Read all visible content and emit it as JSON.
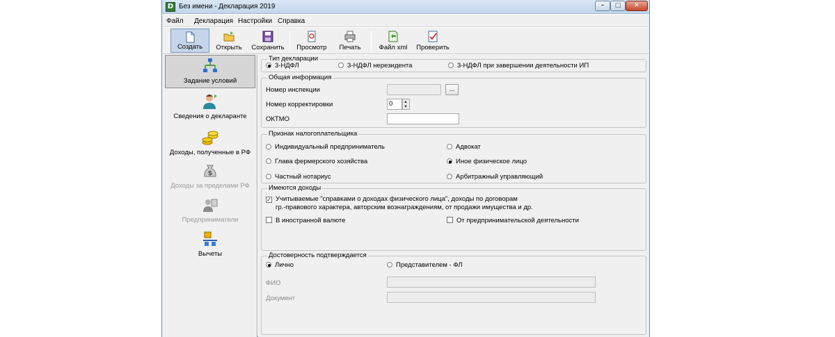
{
  "window": {
    "title": "Без имени - Декларация 2019",
    "app_icon": "D"
  },
  "title_buttons": {
    "minimize": "–",
    "maximize": "□",
    "close": "✕"
  },
  "menu": [
    "Файл",
    "Декларация",
    "Настройки",
    "Справка"
  ],
  "toolbar": [
    {
      "label": "Создать",
      "icon": "new-document-icon",
      "active": true
    },
    {
      "label": "Открыть",
      "icon": "open-folder-icon"
    },
    {
      "label": "Сохранить",
      "icon": "save-floppy-icon"
    },
    {
      "label": "Просмотр",
      "icon": "preview-icon"
    },
    {
      "label": "Печать",
      "icon": "printer-icon"
    },
    {
      "label": "Файл xml",
      "icon": "xml-file-icon"
    },
    {
      "label": "Проверить",
      "icon": "check-document-icon"
    }
  ],
  "sidebar": [
    {
      "label": "Задание условий",
      "icon": "conditions-tree-icon",
      "active": true,
      "enabled": true
    },
    {
      "label": "Сведения о декларанте",
      "icon": "person-icon",
      "enabled": true
    },
    {
      "label": "Доходы, полученные в РФ",
      "icon": "coins-icon",
      "enabled": true
    },
    {
      "label": "Доходы за пределами РФ",
      "icon": "money-bag-icon",
      "enabled": false
    },
    {
      "label": "Предприниматели",
      "icon": "entrepreneur-icon",
      "enabled": false
    },
    {
      "label": "Вычеты",
      "icon": "deductions-icon",
      "enabled": true
    }
  ],
  "declaration_type": {
    "title": "Тип декларации",
    "options": [
      "3-НДФЛ",
      "3-НДФЛ нерезидента",
      "3-НДФЛ при завершении деятельности ИП"
    ],
    "selected": "3-НДФЛ"
  },
  "general": {
    "title": "Общая информация",
    "inspection_label": "Номер инспекции",
    "inspection_value": "",
    "browse_label": "...",
    "correction_label": "Номер корректировки",
    "correction_value": "0",
    "oktmo_label": "ОКТМО",
    "oktmo_value": ""
  },
  "taxpayer": {
    "title": "Признак налогоплательщика",
    "options": [
      "Индивидуальный предприниматель",
      "Адвокат",
      "Глава фермерского хозяйства",
      "Иное физическое лицо",
      "Частный нотариус",
      "Арбитражный управляющий"
    ],
    "selected": "Иное физическое лицо"
  },
  "income": {
    "title": "Имеются доходы",
    "opt1_line1": "Учитываемые \"справками о доходах физического лица\", доходы по договорам",
    "opt1_line2": "гр.-правового характера, авторским вознаграждениям, от продажи имущества и др.",
    "opt1_checked": true,
    "opt2": "В иностранной валюте",
    "opt2_checked": false,
    "opt3": "От предпринимательской деятельности",
    "opt3_checked": false
  },
  "confirmation": {
    "title": "Достоверность подтверждается",
    "options": [
      "Лично",
      "Представителем - ФЛ"
    ],
    "selected": "Лично",
    "fio_label": "ФИО",
    "doc_label": "Документ"
  }
}
